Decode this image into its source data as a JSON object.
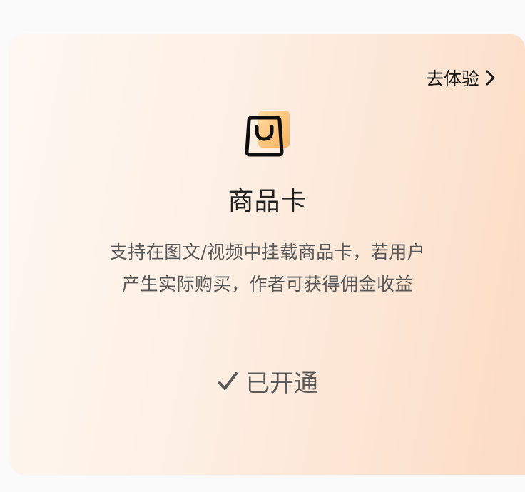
{
  "card": {
    "try_label": "去体验",
    "title": "商品卡",
    "desc_line1": "支持在图文/视频中挂载商品卡，若用户",
    "desc_line2": "产生实际购买，作者可获得佣金收益",
    "status_label": "已开通",
    "icons": {
      "hero": "shopping-bag-icon",
      "try": "chevron-right-icon",
      "status": "checkmark-icon"
    }
  },
  "colors": {
    "accent_gradient": [
      "#ffd89c",
      "#ffb45a"
    ],
    "card_bg_start": "#fff8f2",
    "card_bg_end": "#fcdcc4",
    "text_dark": "#141414",
    "text_muted": "#585858"
  }
}
